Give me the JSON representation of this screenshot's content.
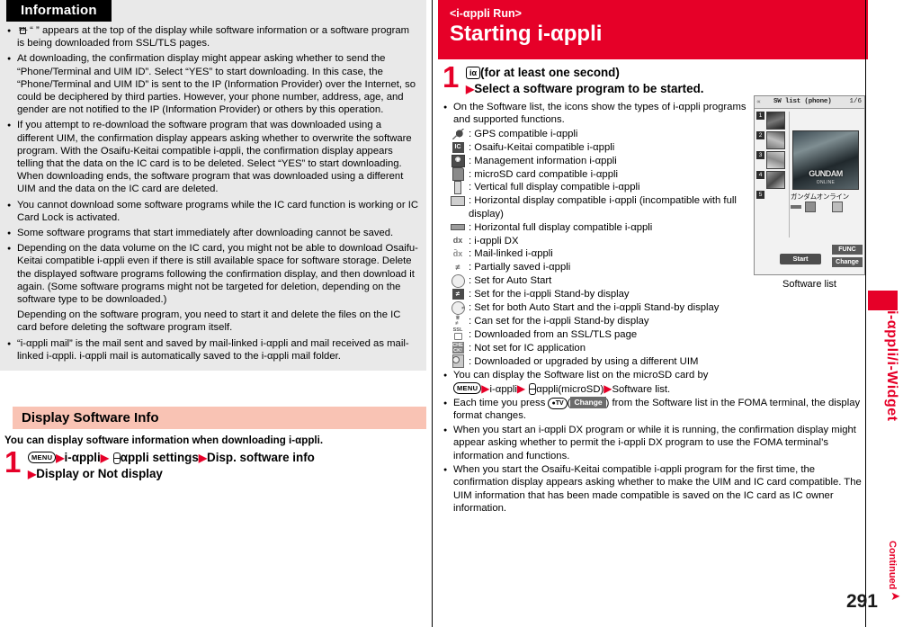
{
  "left": {
    "info_title": "Information",
    "bullets": [
      "“ ” appears at the top of the display while software information or a software program is being downloaded from SSL/TLS pages.",
      "At downloading, the confirmation display might appear asking whether to send the “Phone/Terminal and UIM ID”. Select “YES” to start downloading. In this case, the “Phone/Terminal and UIM ID” is sent to the IP (Information Provider) over the Internet, so could be deciphered by third parties. However, your phone number, address, age, and gender are not notified to the IP (Information Provider) or others by this operation.",
      "If you attempt to re-download the software program that was downloaded using a different UIM, the confirmation display appears asking whether to overwrite the software program. With the Osaifu-Keitai compatible i-αppli, the confirmation display appears telling that the data on the IC card is to be deleted. Select “YES” to start downloading. When downloading ends, the software program that was downloaded using a different UIM and the data on the IC card are deleted.",
      "You cannot download some software programs while the IC card function is working or IC Card Lock is activated.",
      "Some software programs that start immediately after downloading cannot be saved.",
      "Depending on the data volume on the IC card, you might not be able to download Osaifu-Keitai compatible i-αppli even if there is still available space for software storage. Delete the displayed software programs following the confirmation display, and then download it again. (Some software programs might not be targeted for deletion, depending on the software type to be downloaded.)",
      "Depending on the software program, you need to start it and delete the files on the IC card before deleting the software program itself.",
      "“i-αppli mail” is the mail sent and saved by mail-linked i-αppli and mail received as mail-linked i-αppli. i-αppli mail is automatically saved to the i-αppli mail folder."
    ],
    "section_heading": "Display Software Info",
    "section_lead": "You can display software information when downloading i-αppli.",
    "step1": {
      "number": "1",
      "key_menu": "MENU",
      "t1": "i-αppli",
      "t2": "αppli settings",
      "t3": "Disp. software info",
      "t4": "Display or Not display"
    }
  },
  "right": {
    "header_kicker": "<i-αppli Run>",
    "header_title": "Starting i-αppli",
    "step1": {
      "number": "1",
      "key_ia": "iα",
      "line1": "(for at least one second)",
      "line2": "Select a software program to be started."
    },
    "intro_bullet": "On the Software list, the icons show the types of i-αppli programs and supported functions.",
    "legend": [
      {
        "icon": "gps-icon",
        "label": ": GPS compatible i-αppli"
      },
      {
        "icon": "osaifu-keitai-icon",
        "label": ": Osaifu-Keitai compatible i-αppli"
      },
      {
        "icon": "management-info-icon",
        "label": ": Management information i-αppli"
      },
      {
        "icon": "microsd-card-icon",
        "label": ": microSD card compatible i-αppli"
      },
      {
        "icon": "vertical-full-display-icon",
        "label": ": Vertical full display compatible i-αppli"
      },
      {
        "icon": "horizontal-display-icon",
        "label": ": Horizontal display compatible i-αppli (incompatible with full display)"
      },
      {
        "icon": "horizontal-full-display-icon",
        "label": ": Horizontal full display compatible i-αppli"
      },
      {
        "icon": "iappli-dx-icon",
        "label": ": i-αppli DX"
      },
      {
        "icon": "mail-linked-icon",
        "label": ": Mail-linked i-αppli"
      },
      {
        "icon": "partially-saved-icon",
        "label": ": Partially saved i-αppli"
      },
      {
        "icon": "auto-start-icon",
        "label": ": Set for Auto Start"
      },
      {
        "icon": "standby-display-icon",
        "label": ": Set for the i-αppli Stand-by display"
      },
      {
        "icon": "auto-start-and-standby-icon",
        "label": ": Set for both Auto Start and the i-αppli Stand-by display"
      },
      {
        "icon": "can-set-standby-icon",
        "label": ": Can set for the i-αppli Stand-by display"
      },
      {
        "icon": "ssl-tls-icon",
        "label": ": Downloaded from an SSL/TLS page"
      },
      {
        "icon": "not-set-ic-app-icon",
        "label": ": Not set for IC application"
      },
      {
        "icon": "different-uim-icon",
        "label": ": Downloaded or upgraded by using a different UIM"
      }
    ],
    "bullet_microsd": {
      "lead": "You can display the Software list on the microSD card by",
      "key_menu": "MENU",
      "t1": "i-αppli",
      "t2": "αppli(microSD)",
      "t3": "Software list."
    },
    "bullet_change": {
      "pre": "Each time you press ",
      "key_cam": "●TV",
      "soft_label": "Change",
      "post": ") from the Software list in the FOMA terminal, the display format changes."
    },
    "bullet_dx": "When you start an i-αppli DX program or while it is running, the confirmation display might appear asking whether to permit the i-αppli DX program to use the FOMA terminal’s information and functions.",
    "bullet_osaifu": "When you start the Osaifu-Keitai compatible i-αppli program for the first time, the confirmation display appears asking whether to make the UIM and IC card compatible. The UIM information that has been made compatible is saved on the IC card as IC owner information."
  },
  "screenshot": {
    "status_left": "∝",
    "status_title": "SW list (phone)",
    "status_page": "1/6",
    "items": [
      "1",
      "2",
      "3",
      "4",
      "5"
    ],
    "app_title_jp": "ガンダムオンライン",
    "art_title": "GUNDAM",
    "art_sub": "ONLINE",
    "soft_start": "Start",
    "soft_func": "FUNC",
    "soft_change": "Change",
    "caption": "Software list"
  },
  "furniture": {
    "side_tab": "i-αppli/i-Widget",
    "continued": "Continued",
    "page_number": "291",
    "accent_red": "#e60028",
    "band_peach": "#f9c3b4",
    "info_bg": "#e9e9e9"
  }
}
